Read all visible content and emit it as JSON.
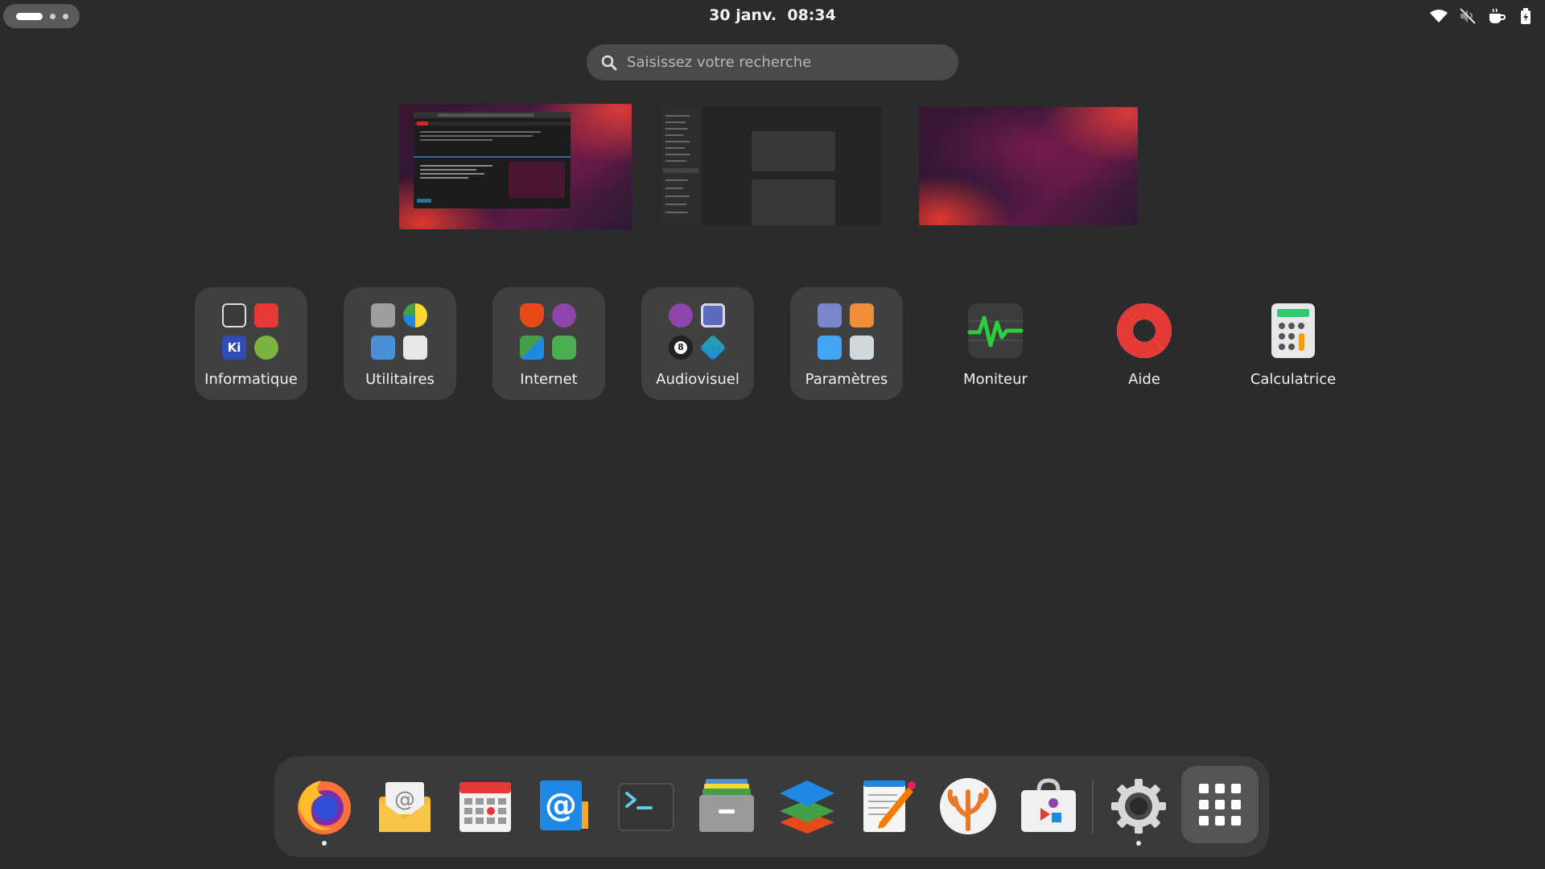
{
  "topbar": {
    "clock": "30 janv.  08:34",
    "tray": [
      "wifi-icon",
      "volume-muted-icon",
      "coffee-icon",
      "battery-icon"
    ]
  },
  "search": {
    "placeholder": "Saisissez votre recherche"
  },
  "app_grid": [
    {
      "label": "Informatique",
      "type": "folder"
    },
    {
      "label": "Utilitaires",
      "type": "folder"
    },
    {
      "label": "Internet",
      "type": "folder"
    },
    {
      "label": "Audiovisuel",
      "type": "folder"
    },
    {
      "label": "Paramètres",
      "type": "folder"
    },
    {
      "label": "Moniteur",
      "type": "app",
      "icon": "system-monitor-icon"
    },
    {
      "label": "Aide",
      "type": "app",
      "icon": "help-lifebuoy-icon"
    },
    {
      "label": "Calculatrice",
      "type": "app",
      "icon": "calculator-icon"
    }
  ],
  "folder_minis": {
    "informatique": {
      "mini_3": "Ki"
    },
    "audiovisuel": {
      "mini_3": "8"
    }
  },
  "dock": [
    "firefox-icon",
    "mail-icon",
    "calendar-icon",
    "contacts-mail-icon",
    "terminal-icon",
    "files-icon",
    "layers-icon",
    "text-editor-icon",
    "coral-app-icon",
    "software-store-icon",
    "settings-gear-icon",
    "show-apps-grid-icon"
  ],
  "colors": {
    "background": "#2b2b2b",
    "panel": "#3a3a3a",
    "folder": "#404040",
    "accent_red": "#e0382e"
  }
}
